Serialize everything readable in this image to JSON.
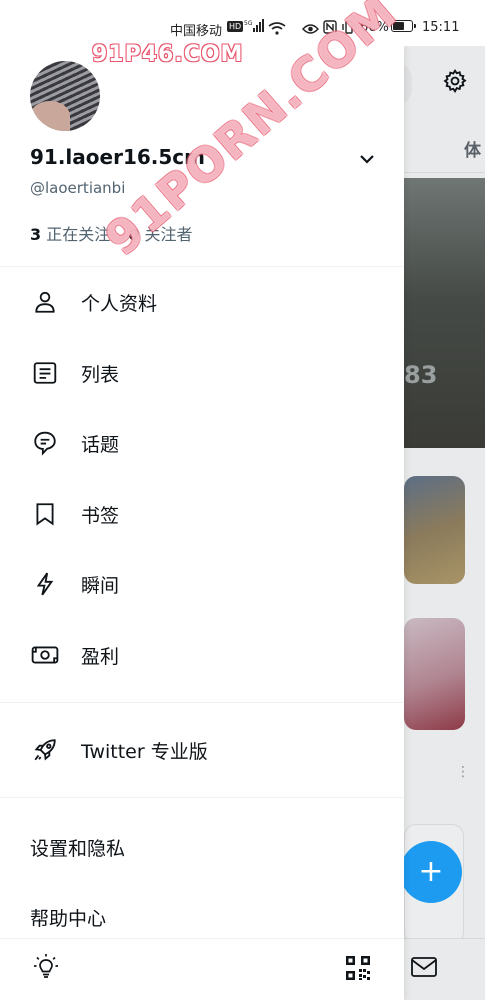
{
  "status_bar": {
    "carrier": "中国移动",
    "hd": "HD",
    "network": "5G",
    "battery_percent_text": "66%",
    "battery_level": 0.66,
    "time": "15:11"
  },
  "watermarks": {
    "top": "91P46.COM",
    "diagonal": "91PORN.COM"
  },
  "profile": {
    "display_name": "91.laoer16.5cm",
    "handle": "@laoertianbi",
    "following_count": "3",
    "following_label": "正在关注",
    "followers_count": "0",
    "followers_label": "关注者"
  },
  "menu": {
    "items": [
      {
        "label": "个人资料",
        "icon": "person-icon"
      },
      {
        "label": "列表",
        "icon": "list-icon"
      },
      {
        "label": "话题",
        "icon": "topics-icon"
      },
      {
        "label": "书签",
        "icon": "bookmark-icon"
      },
      {
        "label": "瞬间",
        "icon": "moments-icon"
      },
      {
        "label": "盈利",
        "icon": "monetization-icon"
      }
    ],
    "professional": {
      "label": "Twitter 专业版",
      "icon": "rocket-icon"
    },
    "settings_label": "设置和隐私",
    "help_label": "帮助中心"
  },
  "background": {
    "tab_text": "体",
    "photo_number": "83",
    "fab_symbol": "+",
    "more_symbol": "⋮"
  },
  "colors": {
    "accent": "#1d9bf0",
    "text_primary": "#0f1419",
    "text_secondary": "#536471",
    "watermark": "#e8556d"
  }
}
